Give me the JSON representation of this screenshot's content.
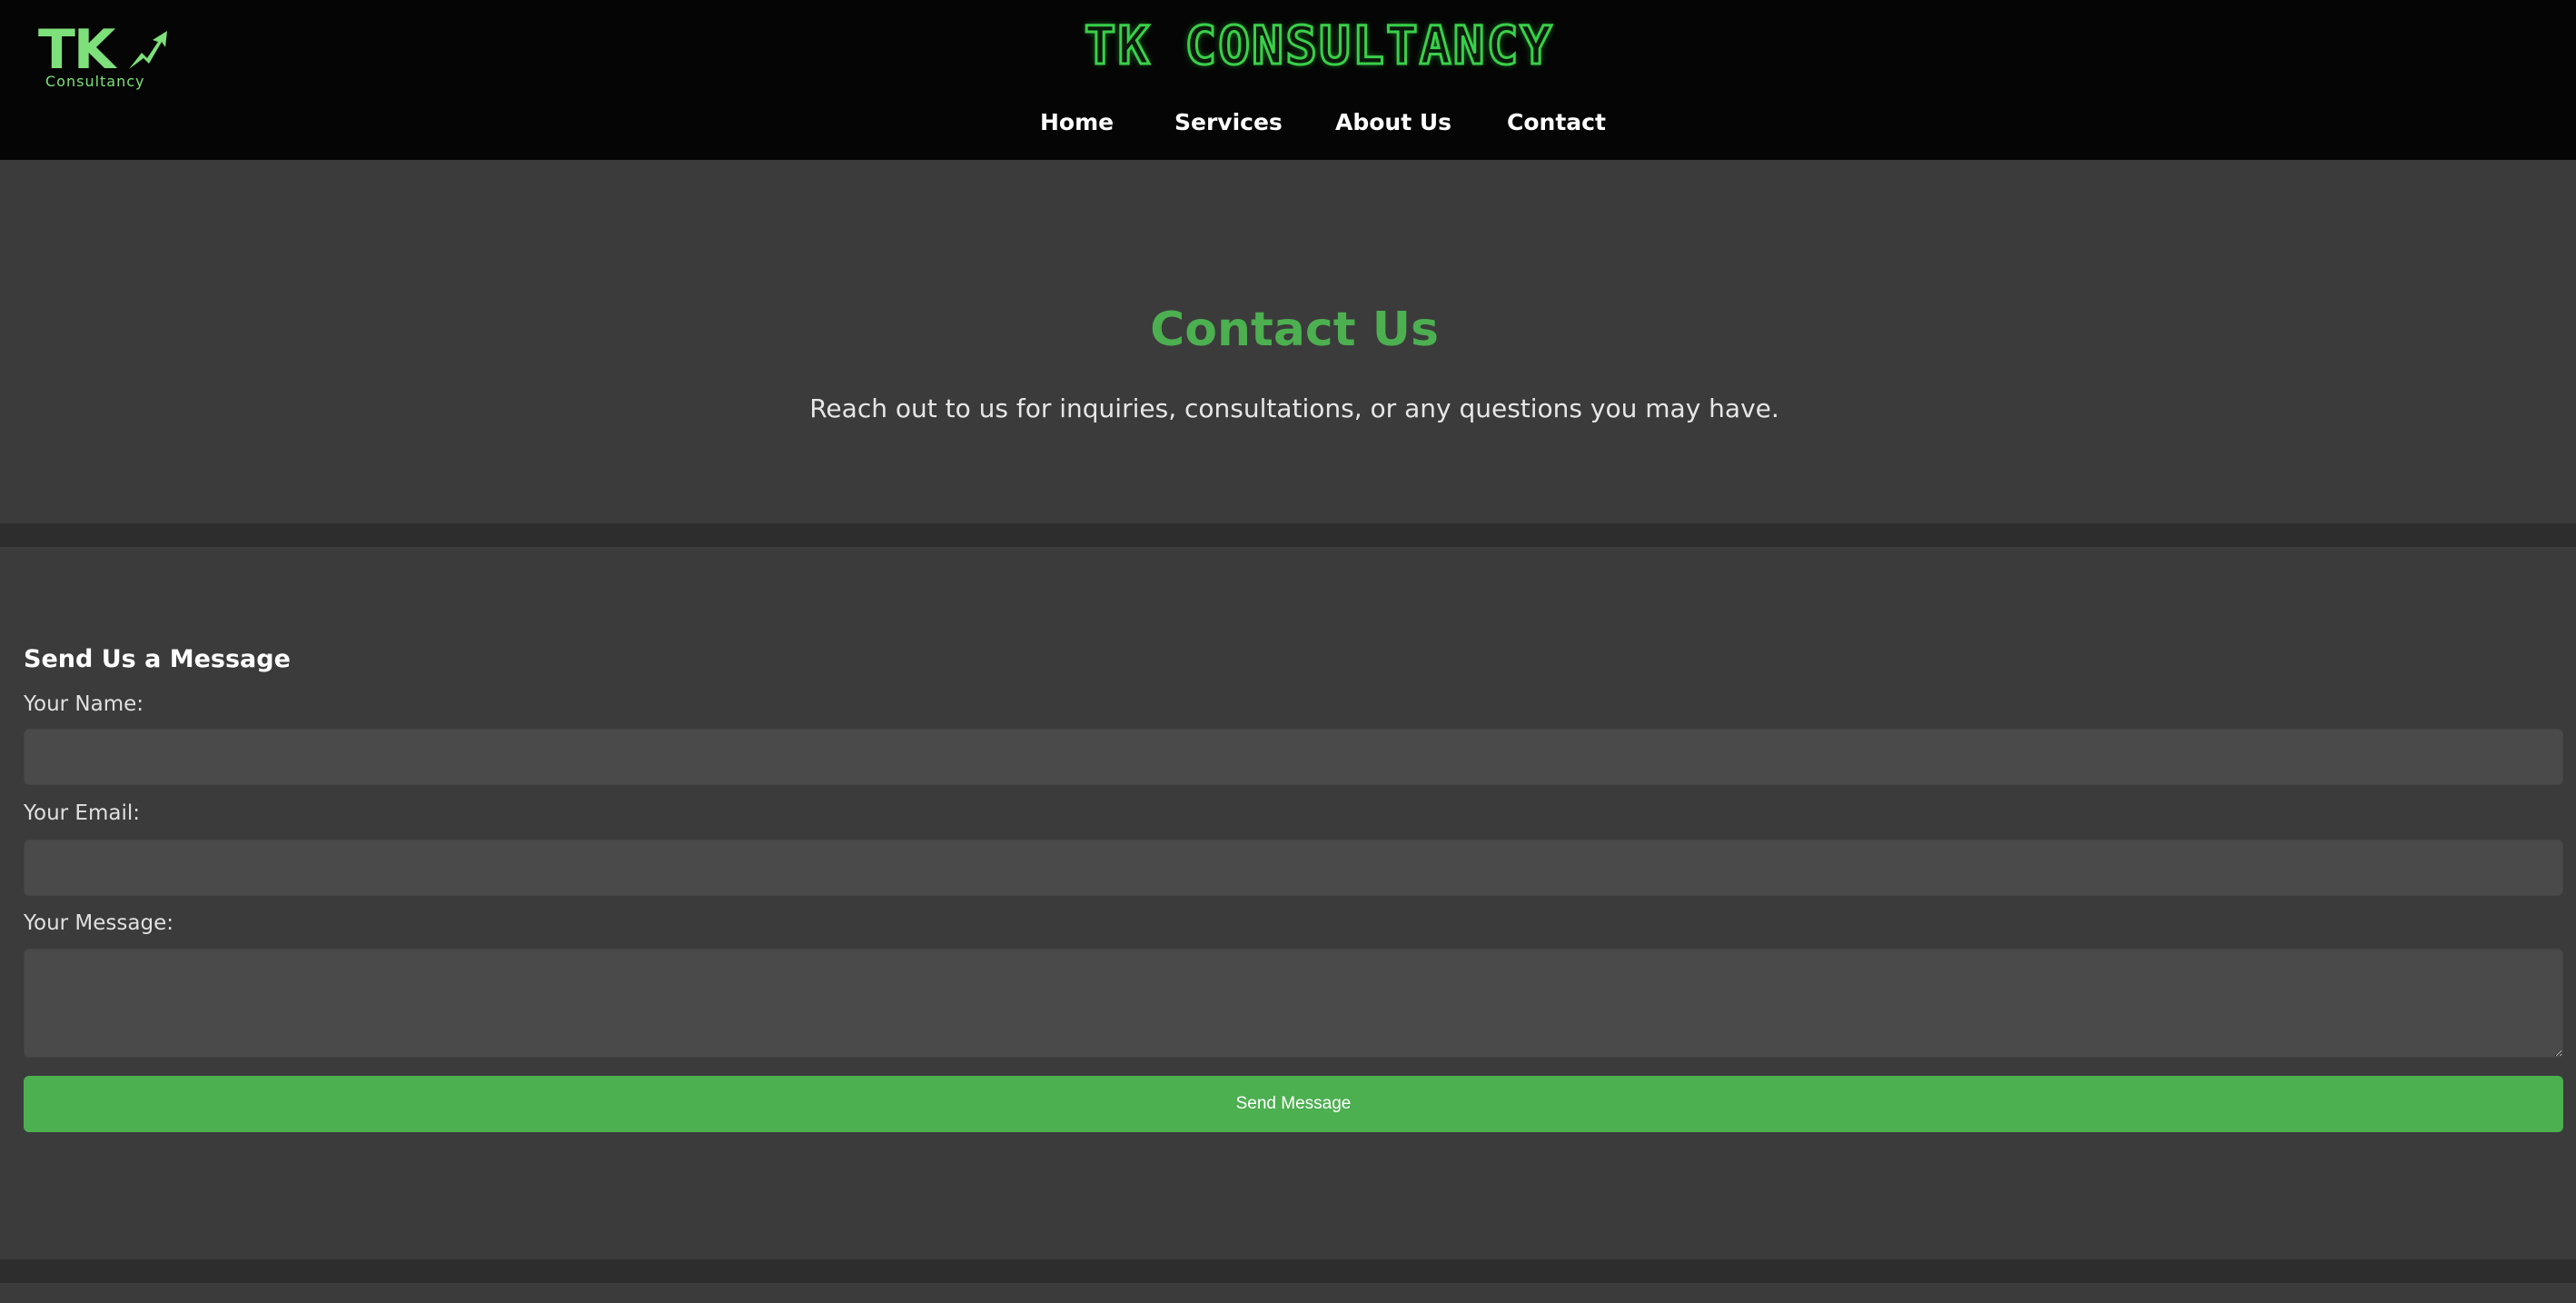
{
  "logo": {
    "mark": "TK",
    "subtitle": "Consultancy"
  },
  "header": {
    "brand_title": "TK CONSULTANCY"
  },
  "nav": {
    "items": [
      {
        "label": "Home"
      },
      {
        "label": "Services"
      },
      {
        "label": "About Us"
      },
      {
        "label": "Contact"
      }
    ]
  },
  "hero": {
    "title": "Contact Us",
    "subtitle": "Reach out to us for inquiries, consultations, or any questions you may have."
  },
  "form": {
    "heading": "Send Us a Message",
    "name_label": "Your Name:",
    "name_value": "",
    "email_label": "Your Email:",
    "email_value": "",
    "message_label": "Your Message:",
    "message_value": "",
    "submit_label": "Send Message"
  },
  "colors": {
    "accent": "#4caf50",
    "header_bg": "#050505",
    "panel_bg": "#3b3b3b",
    "page_bg": "#2d2d2d",
    "input_bg": "#4a4a4a",
    "logo_green": "#7ee07a"
  },
  "icons": {
    "logo_arrow": "trending-up-arrow-icon"
  }
}
